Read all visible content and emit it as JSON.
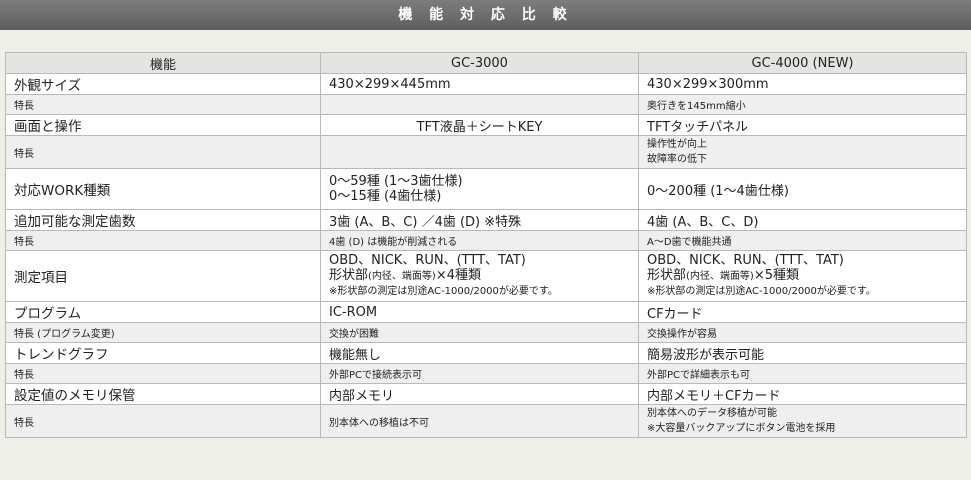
{
  "banner_title": "機 能 対 応 比 較",
  "header": {
    "feature": "機能",
    "gc3000": "GC-3000",
    "gc4000": "GC-4000 (NEW)"
  },
  "rows": [
    {
      "label": "外観サイズ",
      "gc3000": "430×299×445mm",
      "gc4000": "430×299×300mm"
    },
    {
      "label": "特長",
      "gc3000": "",
      "gc4000": "奥行きを145mm縮小"
    },
    {
      "label": "画面と操作",
      "gc3000": "TFT液晶＋シートKEY",
      "gc4000": "TFTタッチパネル"
    },
    {
      "label": "特長",
      "gc3000": "",
      "gc4000_1": "操作性が向上",
      "gc4000_2": "故障率の低下"
    },
    {
      "label": "対応WORK種類",
      "gc3000_1": "0〜59種 (1〜3歯仕様)",
      "gc3000_2": "0〜15種 (4歯仕様)",
      "gc4000": "0〜200種 (1〜4歯仕様)"
    },
    {
      "label": "追加可能な測定歯数",
      "gc3000": "3歯 (A、B、C) ／4歯 (D) ※特殊",
      "gc4000": "4歯 (A、B、C、D)"
    },
    {
      "label": "特長",
      "gc3000": "4歯 (D) は機能が削減される",
      "gc4000": "A〜D歯で機能共通"
    },
    {
      "label": "測定項目",
      "gc3000_1": "OBD、NICK、RUN、(TTT、TAT)",
      "gc3000_2a": "形状部",
      "gc3000_2b": "(内径、端面等)",
      "gc3000_2c": "×4種類",
      "gc3000_3": "※形状部の測定は別途AC-1000/2000が必要です。",
      "gc4000_1": "OBD、NICK、RUN、(TTT、TAT)",
      "gc4000_2a": "形状部",
      "gc4000_2b": "(内径、端面等)",
      "gc4000_2c": "×5種類",
      "gc4000_3": "※形状部の測定は別途AC-1000/2000が必要です。"
    },
    {
      "label": "プログラム",
      "gc3000": "IC-ROM",
      "gc4000": "CFカード"
    },
    {
      "label": "特長 (プログラム変更)",
      "gc3000": "交換が困難",
      "gc4000": "交換操作が容易"
    },
    {
      "label": "トレンドグラフ",
      "gc3000": "機能無し",
      "gc4000": "簡易波形が表示可能"
    },
    {
      "label": "特長",
      "gc3000": "外部PCで接続表示可",
      "gc4000": "外部PCで詳細表示も可"
    },
    {
      "label": "設定値のメモリ保管",
      "gc3000": "内部メモリ",
      "gc4000": "内部メモリ＋CFカード"
    },
    {
      "label": "特長",
      "gc3000": "別本体への移植は不可",
      "gc4000_1": "別本体へのデータ移植が可能",
      "gc4000_2": "※大容量バックアップにボタン電池を採用"
    }
  ]
}
